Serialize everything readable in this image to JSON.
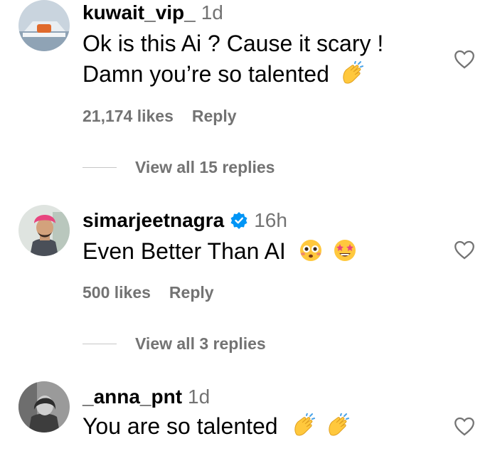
{
  "comments": [
    {
      "username": "kuwait_vip_",
      "time": "1d",
      "text_line1": "Ok is this Ai ? Cause it scary !",
      "text_line2": "Damn you’re so talented",
      "likes": "21,174 likes",
      "reply_label": "Reply",
      "view_replies": "View all 15 replies",
      "emojis": [
        "clapping-hands"
      ]
    },
    {
      "username": "simarjeetnagra",
      "verified": true,
      "time": "16h",
      "text": "Even Better Than AI",
      "likes": "500 likes",
      "reply_label": "Reply",
      "view_replies": "View all 3 replies",
      "emojis": [
        "flushed-face",
        "star-struck"
      ]
    },
    {
      "username": "_anna_pnt",
      "time": "1d",
      "text": "You are so talented",
      "emojis": [
        "clapping-hands",
        "clapping-hands"
      ]
    }
  ],
  "colors": {
    "secondary_text": "#737373",
    "verified_blue": "#0095f6",
    "emoji_yellow": "#ffc83d"
  },
  "icons": [
    "heart-outline-icon",
    "verified-badge-icon"
  ]
}
